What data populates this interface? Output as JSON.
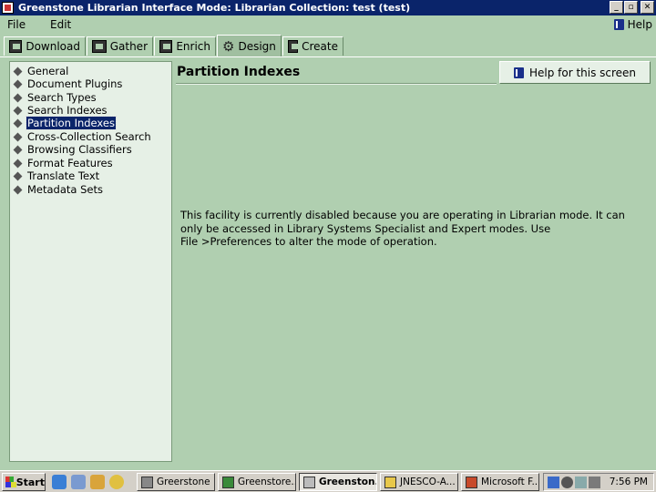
{
  "window": {
    "title": "Greenstone Librarian Interface  Mode: Librarian  Collection: test (test)",
    "controls": {
      "minimize": "_",
      "maximize": "▫",
      "close": "✕"
    }
  },
  "menu": {
    "file": "File",
    "edit": "Edit",
    "help": "Help"
  },
  "tabs": [
    {
      "label": "Download",
      "active": false
    },
    {
      "label": "Gather",
      "active": false
    },
    {
      "label": "Enrich",
      "active": false
    },
    {
      "label": "Design",
      "active": true
    },
    {
      "label": "Create",
      "active": false
    }
  ],
  "sidebar": {
    "items": [
      {
        "label": "General"
      },
      {
        "label": "Document Plugins"
      },
      {
        "label": "Search Types"
      },
      {
        "label": "Search Indexes"
      },
      {
        "label": "Partition Indexes",
        "selected": true
      },
      {
        "label": "Cross-Collection Search"
      },
      {
        "label": "Browsing Classifiers"
      },
      {
        "label": "Format Features"
      },
      {
        "label": "Translate Text"
      },
      {
        "label": "Metadata Sets"
      }
    ]
  },
  "main": {
    "title": "Partition Indexes",
    "help_button": "Help for this screen",
    "message_lines": [
      "This facility is currently disabled because you are operating in Librarian mode. It can",
      "only be accessed in Library Systems Specialist and Expert modes. Use",
      "File >Preferences to alter the mode of operation."
    ]
  },
  "taskbar": {
    "start": "Start",
    "tasks": [
      {
        "label": "Greerstone ..",
        "active": false
      },
      {
        "label": "Greenstore...",
        "active": false
      },
      {
        "label": "Greenston...",
        "active": true
      },
      {
        "label": "JNESCO-A...",
        "active": false
      },
      {
        "label": "Microsoft F...",
        "active": false
      }
    ],
    "clock": "7:56 PM"
  },
  "icons": {
    "app": "greenstone-app-icon",
    "help": "help-book-icon",
    "download": "download-icon",
    "gather": "gather-icon",
    "enrich": "enrich-icon",
    "design": "gear-icon",
    "create": "create-icon"
  }
}
